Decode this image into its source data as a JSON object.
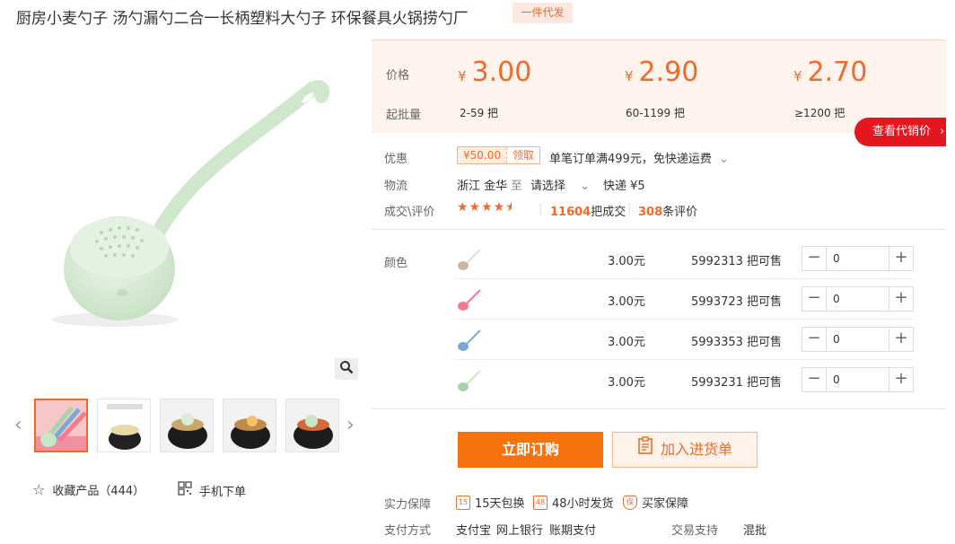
{
  "product": {
    "title": "厨房小麦勺子 汤勺漏勺二合一长柄塑料大勺子 环保餐具火锅捞勺厂",
    "badge": "一件代发"
  },
  "gallery": {
    "favorite_label": "收藏产品",
    "favorite_count": "（444）",
    "mobile_order_label": "手机下单"
  },
  "pricing": {
    "price_label": "价格",
    "qty_label": "起批量",
    "currency": "¥",
    "tiers": [
      {
        "price": "3.00",
        "range": "2-59  把"
      },
      {
        "price": "2.90",
        "range": "60-1199  把"
      },
      {
        "price": "2.70",
        "range": "≥1200  把"
      }
    ],
    "reseller_button": "查看代销价"
  },
  "promo": {
    "label": "优惠",
    "coupon_amount": "¥50.00",
    "coupon_get": "领取",
    "description": "单笔订单满499元，免快递运费"
  },
  "logistics": {
    "label": "物流",
    "origin": "浙江 金华",
    "to": "至",
    "destination": "请选择",
    "express": "快递 ¥5"
  },
  "reviews": {
    "label": "成交\\评价",
    "rating": 4.5,
    "deals_count": "11604",
    "deals_suffix": "把成交",
    "review_count": "308",
    "review_suffix": "条评价"
  },
  "sku": {
    "label": "颜色",
    "rows": [
      {
        "price": "3.00元",
        "stock": "5992313 把可售",
        "qty": "0",
        "color": "#c9b7a5"
      },
      {
        "price": "3.00元",
        "stock": "5993723 把可售",
        "qty": "0",
        "color": "#f07c92"
      },
      {
        "price": "3.00元",
        "stock": "5993353 把可售",
        "qty": "0",
        "color": "#7aa9d6"
      },
      {
        "price": "3.00元",
        "stock": "5993231 把可售",
        "qty": "0",
        "color": "#a9d3a9"
      }
    ]
  },
  "actions": {
    "order_now": "立即订购",
    "add_to_cart": "加入进货单"
  },
  "service": {
    "guarantee_label": "实力保障",
    "items": [
      {
        "icon_text": "15",
        "label": "15天包换"
      },
      {
        "icon_text": "48",
        "label": "48小时发货"
      },
      {
        "icon_text": "保",
        "label": "买家保障"
      }
    ],
    "payment_label": "支付方式",
    "payments": [
      "支付宝",
      "网上银行",
      "账期支付"
    ],
    "trade_support_label": "交易支持",
    "trade_support_value": "混批"
  },
  "colors": {
    "accent": "#f06a2b",
    "order_button": "#f5720f",
    "reseller_button": "#e4161f",
    "price_panel_bg": "#fff4ed",
    "product_green": "#d9ecd6"
  }
}
